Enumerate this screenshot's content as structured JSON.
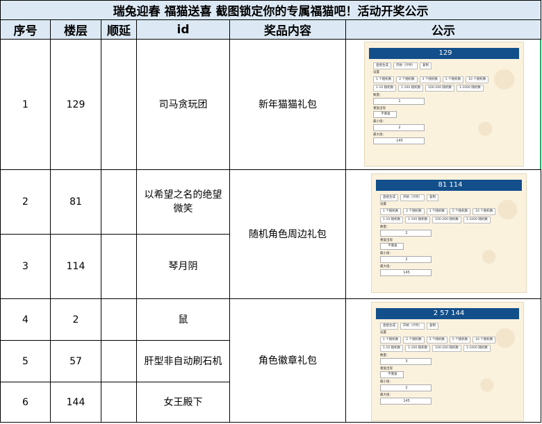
{
  "title": "瑞兔迎春 福猫送喜 截图锁定你的专属福猫吧！活动开奖公示",
  "headers": [
    "序号",
    "楼层",
    "顺延",
    "id",
    "奖品内容",
    "公示"
  ],
  "rows": [
    {
      "no": "1",
      "floor": "129",
      "shunyan": "",
      "id": "司马贪玩团"
    },
    {
      "no": "2",
      "floor": "81",
      "shunyan": "",
      "id": "以希望之名的绝望微笑"
    },
    {
      "no": "3",
      "floor": "114",
      "shunyan": "",
      "id": "琴月阴"
    },
    {
      "no": "4",
      "floor": "2",
      "shunyan": "",
      "id": "鼠"
    },
    {
      "no": "5",
      "floor": "57",
      "shunyan": "",
      "id": "肝型非自动刷石机"
    },
    {
      "no": "6",
      "floor": "144",
      "shunyan": "",
      "id": "女王殿下"
    }
  ],
  "prizes": [
    "新年猫猫礼包",
    "随机角色周边礼包",
    "角色徽章礼包"
  ],
  "generator": {
    "buttons_top": [
      "直接生成",
      "开始（计时）",
      "复制"
    ],
    "settings_label": "设置",
    "row1": [
      "1 个随机数",
      "2 个随机数",
      "3 个随机数",
      "5 个随机数",
      "10 个随机数"
    ],
    "row2": [
      "1-10 随机数",
      "1-100 随机数",
      "100-200 随机数",
      "1-1000 随机数"
    ],
    "count_label": "数量：",
    "repeat_label": "重复出现",
    "repeat_value": "不重复",
    "min_label": "最小值：",
    "max_label": "最大值：",
    "min_value": "2",
    "max_value": "145",
    "panels": [
      {
        "result": "129",
        "count": "1"
      },
      {
        "result": "81 114",
        "count": "2"
      },
      {
        "result": "2 57 144",
        "count": "3"
      }
    ]
  }
}
